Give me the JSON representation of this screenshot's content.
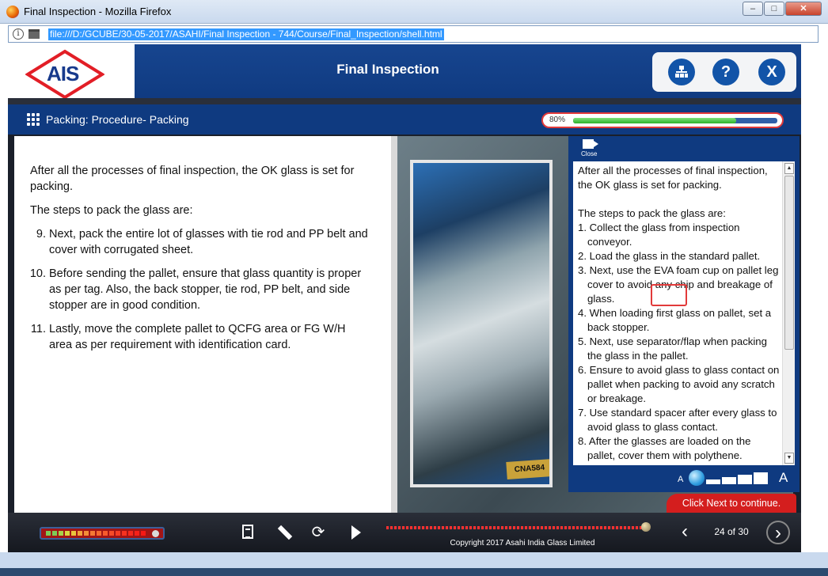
{
  "window": {
    "title": "Final Inspection - Mozilla Firefox",
    "url": "file:///D:/GCUBE/30-05-2017/ASAHI/Final Inspection - 744/Course/Final_Inspection/shell.html",
    "min_label": "–",
    "max_label": "□",
    "close_label": "✕"
  },
  "header": {
    "logo_text": "AIS",
    "title": "Final Inspection",
    "help_label": "?",
    "exit_label": "X"
  },
  "subbar": {
    "title": "Packing: Procedure- Packing",
    "progress_label": "80%",
    "progress_value": 0.8
  },
  "content": {
    "intro": "After all the processes of final inspection, the OK glass is set for packing.",
    "steps_heading": "The steps to pack the glass are:",
    "steps": [
      {
        "num": "9.",
        "text": "Next, pack the entire lot of glasses with tie rod and PP belt and cover with corrugated sheet."
      },
      {
        "num": "10.",
        "text": "Before sending the pallet, ensure that glass quantity is proper as per tag. Also, the back stopper, tie rod, PP belt, and side stopper are in good condition."
      },
      {
        "num": "11.",
        "text": "Lastly, move the complete pallet to QCFG area or FG W/H area as per requirement with identification card."
      }
    ],
    "photo_plate": "CNA584"
  },
  "transcript": {
    "close_label": "Close",
    "intro": "After all the processes of final inspection, the OK glass is set for packing.",
    "steps_heading": "The steps to pack the glass are:",
    "items": [
      "1. Collect the glass from inspection conveyor.",
      "2. Load the glass in the standard pallet.",
      "3. Next, use the EVA foam cup on pallet leg cover to avoid any chip and breakage of glass.",
      "4. When loading first glass on pallet, set a back stopper.",
      "5. Next, use separator/flap when packing the glass in the pallet.",
      "6. Ensure to avoid glass to glass contact on pallet when packing to avoid any scratch or breakage.",
      "7. Use standard spacer after every glass to avoid glass to glass contact.",
      "8. After the glasses are loaded on the pallet, cover them with polythene."
    ],
    "font_small": "A",
    "font_big": "A"
  },
  "next_hint": "Click Next to continue.",
  "footer": {
    "copyright": "Copyright 2017 Asahi India Glass Limited",
    "page_count": "24 of 30",
    "prev_label": "‹",
    "next_label": "›"
  },
  "colors": {
    "brand_blue": "#0f3a80",
    "accent_red": "#d41e1e",
    "progress_green": "#2db12a"
  }
}
